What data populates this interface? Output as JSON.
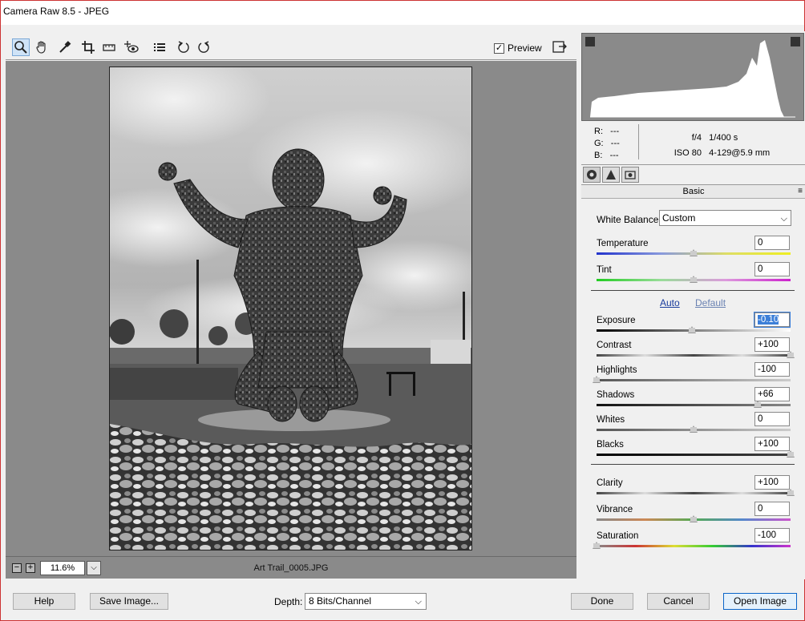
{
  "window": {
    "title": "Camera Raw 8.5  -  JPEG"
  },
  "toolbar": {
    "tools": [
      "zoom-icon",
      "hand-icon",
      "white-balance-icon",
      "crop-icon",
      "straighten-icon",
      "redeye-icon",
      "list-icon",
      "rotate-left-icon",
      "rotate-right-icon"
    ],
    "preview_label": "Preview",
    "preview_checked": "✓"
  },
  "status": {
    "zoom_value": "11.6%",
    "filename": "Art Trail_0005.JPG",
    "minus": "−",
    "plus": "+"
  },
  "readout": {
    "r_label": "R:",
    "r_value": "---",
    "g_label": "G:",
    "g_value": "---",
    "b_label": "B:",
    "b_value": "---",
    "aperture": "f/4",
    "shutter": "1/400 s",
    "iso": "ISO 80",
    "lens": "4-129@5.9 mm"
  },
  "panel": {
    "title": "Basic",
    "menu_icon": "≡",
    "white_balance_label": "White Balance:",
    "white_balance_value": "Custom",
    "auto_label": "Auto",
    "default_label": "Default",
    "sliders": [
      {
        "label": "Temperature",
        "value": "0",
        "level": 0.5,
        "gradient": "temp"
      },
      {
        "label": "Tint",
        "value": "0",
        "level": 0.5,
        "gradient": "tint"
      },
      {
        "label": "Exposure",
        "value": "-0.10",
        "level": 0.49,
        "gradient": "exposure",
        "selected": true
      },
      {
        "label": "Contrast",
        "value": "+100",
        "level": 1.0,
        "gradient": "contrast"
      },
      {
        "label": "Highlights",
        "value": "-100",
        "level": 0.0,
        "gradient": "grey"
      },
      {
        "label": "Shadows",
        "value": "+66",
        "level": 0.83,
        "gradient": "shadow"
      },
      {
        "label": "Whites",
        "value": "0",
        "level": 0.5,
        "gradient": "grey"
      },
      {
        "label": "Blacks",
        "value": "+100",
        "level": 1.0,
        "gradient": "blacks"
      },
      {
        "label": "Clarity",
        "value": "+100",
        "level": 1.0,
        "gradient": "contrast"
      },
      {
        "label": "Vibrance",
        "value": "0",
        "level": 0.5,
        "gradient": "vibrance"
      },
      {
        "label": "Saturation",
        "value": "-100",
        "level": 0.0,
        "gradient": "saturation"
      }
    ]
  },
  "buttons": {
    "help": "Help",
    "save_image": "Save Image...",
    "depth_label": "Depth:",
    "depth_value": "8 Bits/Channel",
    "done": "Done",
    "cancel": "Cancel",
    "open_image": "Open Image"
  }
}
